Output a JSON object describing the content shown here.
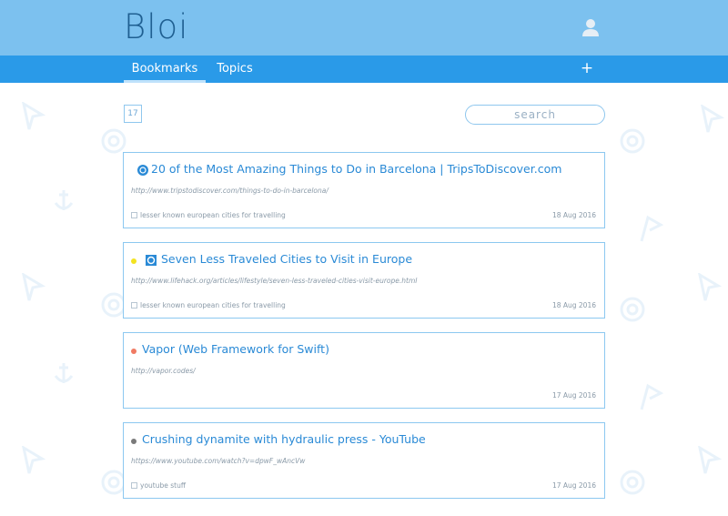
{
  "app": {
    "title": "Bloi"
  },
  "nav": {
    "tabs": [
      {
        "label": "Bookmarks"
      },
      {
        "label": "Topics"
      }
    ],
    "add_icon": "plus-icon"
  },
  "toolbar": {
    "count": "17",
    "search_placeholder": "search"
  },
  "colors": {
    "header": "#7cc1ef",
    "nav": "#2a9ae8",
    "accent": "#2a8ad6"
  },
  "bookmarks": [
    {
      "title": "20 of the Most Amazing Things to Do in Barcelona | TripsToDiscover.com",
      "url": "http://www.tripstodiscover.com/things-to-do-in-barcelona/",
      "topic": "lesser known european cities for travelling",
      "date": "18 Aug 2016",
      "dot_color": "",
      "favicon": "trips-favicon"
    },
    {
      "title": "Seven Less Traveled Cities to Visit in Europe",
      "url": "http://www.lifehack.org/articles/lifestyle/seven-less-traveled-cities-visit-europe.html",
      "topic": "lesser known european cities for travelling",
      "date": "18 Aug 2016",
      "dot_color": "#f3e321",
      "favicon": "lifehack-favicon"
    },
    {
      "title": "Vapor (Web Framework for Swift)",
      "url": "http://vapor.codes/",
      "topic": "",
      "date": "17 Aug 2016",
      "dot_color": "#f07a63",
      "favicon": ""
    },
    {
      "title": "Crushing dynamite with hydraulic press - YouTube",
      "url": "https://www.youtube.com/watch?v=dpwF_wAncVw",
      "topic": "youtube stuff",
      "date": "17 Aug 2016",
      "dot_color": "#7a7a7a",
      "favicon": ""
    }
  ]
}
